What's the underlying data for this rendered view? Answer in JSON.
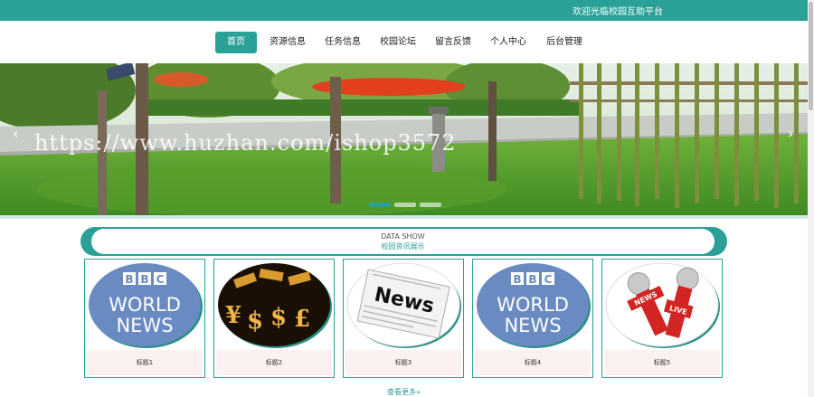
{
  "topbar": {
    "welcome": "欢迎光临校园互助平台",
    "color": "#2aa197"
  },
  "nav": {
    "items": [
      "首页",
      "资源信息",
      "任务信息",
      "校园论坛",
      "留言反馈",
      "个人中心",
      "后台管理"
    ],
    "active_index": 0
  },
  "banner": {
    "watermark": "https://www.huzhan.com/ishop3572",
    "prev": "‹",
    "next": "›",
    "active_slide": 0
  },
  "section": {
    "title_en": "DATA SHOW",
    "title_zh": "校园资讯展示"
  },
  "cards": [
    {
      "title": "标题1",
      "image": "bbc-world-news-logo"
    },
    {
      "title": "标题2",
      "image": "gold-currency-symbols"
    },
    {
      "title": "标题3",
      "image": "newspaper-news"
    },
    {
      "title": "标题4",
      "image": "bbc-world-news-logo"
    },
    {
      "title": "标题5",
      "image": "live-microphones"
    }
  ],
  "image_text": {
    "bbc_letters": [
      "B",
      "B",
      "C"
    ],
    "world": "WORLD",
    "news": "NEWS",
    "newspaper": "News",
    "mic_news": "NEWS",
    "mic_live": "LIVE"
  },
  "more": "查看更多»"
}
